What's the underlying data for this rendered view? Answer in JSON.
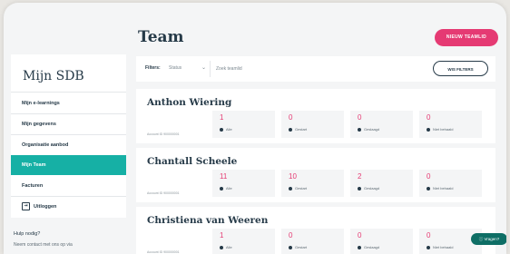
{
  "header": {
    "title": "Team",
    "new_team_button": "NIEUW TEAMLID"
  },
  "sidebar": {
    "brand": "Mijn SDB",
    "items": [
      {
        "label": "Mijn e-learnings",
        "active": false
      },
      {
        "label": "Mijn gegevens",
        "active": false
      },
      {
        "label": "Organisatie aanbod",
        "active": false
      },
      {
        "label": "Mijn Team",
        "active": true
      },
      {
        "label": "Facturen",
        "active": false
      },
      {
        "label": "Uitloggen",
        "active": false,
        "icon": "logout-icon"
      }
    ],
    "help_title": "Hulp nodig?",
    "help_text": "Neem contact met ons op via"
  },
  "filters": {
    "label": "Filters:",
    "status_value": "Status",
    "search_placeholder": "Zoek teamlid",
    "clear_button": "WIS FILTERS"
  },
  "members": [
    {
      "name": "Anthon Wiering",
      "account": "Account ID 900000001",
      "stats": [
        {
          "value": "1",
          "label": "Alle"
        },
        {
          "value": "0",
          "label": "Gestart"
        },
        {
          "value": "0",
          "label": "Geslaagd"
        },
        {
          "value": "0",
          "label": "Niet behaald"
        }
      ]
    },
    {
      "name": "Chantall Scheele",
      "account": "Account ID 900000001",
      "stats": [
        {
          "value": "11",
          "label": "Alle"
        },
        {
          "value": "10",
          "label": "Gestart"
        },
        {
          "value": "2",
          "label": "Geslaagd"
        },
        {
          "value": "0",
          "label": "Niet behaald"
        }
      ]
    },
    {
      "name": "Christiena van Weeren",
      "account": "Account ID 900000001",
      "stats": [
        {
          "value": "1",
          "label": "Alle"
        },
        {
          "value": "0",
          "label": "Gestart"
        },
        {
          "value": "0",
          "label": "Geslaagd"
        },
        {
          "value": "0",
          "label": "Niet behaald"
        }
      ]
    }
  ],
  "chat": {
    "label": "Vragen?"
  },
  "colors": {
    "accent_pink": "#e53a73",
    "active_teal": "#16b0a5",
    "text_dark": "#263a48"
  }
}
